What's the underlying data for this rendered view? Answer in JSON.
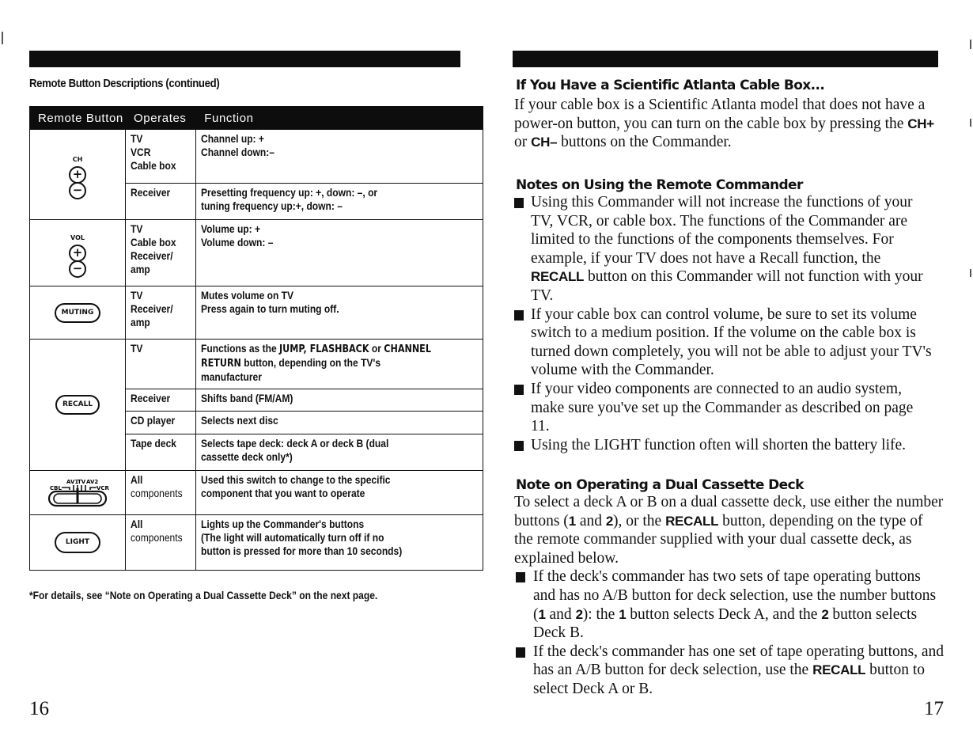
{
  "left_page": {
    "section_title": "Remote Button Descriptions (continued)",
    "table": {
      "headers": [
        "Remote Button",
        "Operates",
        "Function"
      ],
      "rows": [
        {
          "button": {
            "icon": "ch-rocker-icon",
            "label": "CH",
            "plus": "+",
            "minus": "−"
          },
          "entries": [
            {
              "operates": [
                "TV",
                "VCR",
                "Cable box"
              ],
              "function": [
                "Channel up: +",
                "Channel down:–"
              ]
            },
            {
              "operates": [
                "Receiver"
              ],
              "function": [
                "Presetting frequency up: +, down: –, or",
                "tuning frequency up:+, down: –"
              ]
            }
          ]
        },
        {
          "button": {
            "icon": "vol-rocker-icon",
            "label": "VOL",
            "plus": "+",
            "minus": "−"
          },
          "entries": [
            {
              "operates": [
                "TV",
                "Cable box",
                "Receiver/",
                "amp"
              ],
              "function": [
                "Volume up: +",
                "Volume down: –"
              ]
            }
          ]
        },
        {
          "button": {
            "icon": "muting-button-icon",
            "label": "MUTING"
          },
          "entries": [
            {
              "operates": [
                "TV",
                "Receiver/",
                "amp"
              ],
              "function": [
                "Mutes volume on TV",
                "Press again to turn muting off."
              ]
            }
          ]
        },
        {
          "button": {
            "icon": "recall-button-icon",
            "label": "RECALL"
          },
          "entries": [
            {
              "operates": [
                "TV"
              ],
              "function_parts": {
                "pre": "Functions as the ",
                "b1": "JUMP, FLASHBACK",
                "mid": " or ",
                "b2": "CHANNEL RETURN",
                "post": " button, depending on the TV's manufacturer"
              }
            },
            {
              "operates": [
                "Receiver"
              ],
              "function": [
                "Shifts band (FM/AM)"
              ]
            },
            {
              "operates": [
                "CD player"
              ],
              "function": [
                "Selects next disc"
              ]
            },
            {
              "operates": [
                "Tape deck"
              ],
              "function": [
                "Selects tape deck: deck A or deck B (dual",
                "cassette deck only*)"
              ]
            }
          ]
        },
        {
          "button": {
            "icon": "component-switch-icon",
            "labels": [
              "CBL",
              "AV1",
              "TV",
              "AV2",
              "VCR"
            ]
          },
          "entries": [
            {
              "operates": [
                "All",
                "components"
              ],
              "function": [
                "Used this switch to change to the specific",
                "component that you want to operate"
              ]
            }
          ]
        },
        {
          "button": {
            "icon": "light-button-icon",
            "label": "LIGHT"
          },
          "entries": [
            {
              "operates": [
                "All",
                "components"
              ],
              "function": [
                "Lights up the Commander's buttons",
                "(The  light will automatically turn off if no",
                "button is pressed for more than 10 seconds)"
              ]
            }
          ]
        }
      ]
    },
    "footnote": "*For details, see “Note on Operating a Dual Cassette Deck” on the next page.",
    "page_number": "16"
  },
  "right_page": {
    "sections": [
      {
        "heading": "If You Have a Scientific Atlanta Cable Box...",
        "body_parts": {
          "pre": "If your cable box is a Scientific Atlanta model that does not have a power-on button, you can turn on the cable box by pressing the ",
          "b1": "CH+",
          "mid": " or ",
          "b2": "CH–",
          "post": " buttons on the Commander."
        }
      },
      {
        "heading": "Notes on Using the Remote Commander",
        "bullets": [
          {
            "pre": "Using this Commander will not increase the functions of your TV, VCR, or cable box. The functions of the Commander are limited to the functions of the components themselves. For example, if your TV does not have a Recall function, the ",
            "bold": "RECALL",
            "post": " button on this Commander will not function with your TV."
          },
          {
            "pre": "If your cable box can control volume, be sure to set its volume switch to a medium position. If the volume on the cable box is turned down completely, you will not be able to adjust your TV's volume with the Commander.",
            "bold": "",
            "post": ""
          },
          {
            "pre": "If your video components are connected to an audio system, make sure you've set up the Commander as described on page 11.",
            "bold": "",
            "post": ""
          },
          {
            "pre": "Using the LIGHT function often will shorten the battery life.",
            "bold": "",
            "post": ""
          }
        ]
      },
      {
        "heading": "Note on Operating a Dual Cassette Deck",
        "body_parts": {
          "pre": "To select a deck A or B on a dual cassette deck, use either the number buttons (",
          "b1": "1",
          "mid1": " and ",
          "b2": "2",
          "mid2": "), or the ",
          "b3": "RECALL",
          "post": " button, depending on the type of the remote commander supplied with your dual cassette deck, as explained below."
        },
        "bullets": [
          {
            "p1": "If the deck's commander has two sets of tape operating buttons and has no A/B button for deck selection, use the number buttons (",
            "b1": "1",
            "p2": " and ",
            "b2": "2",
            "p3": "): the ",
            "b3": "1",
            "p4": " button selects Deck A, and the ",
            "b4": "2",
            "p5": " button selects Deck B."
          },
          {
            "p1": "If the deck's commander has one set of tape operating buttons, and has an A/B button for deck selection, use the ",
            "b1": "RECALL",
            "p2": " button to select Deck A or B."
          }
        ]
      }
    ],
    "page_number": "17"
  }
}
